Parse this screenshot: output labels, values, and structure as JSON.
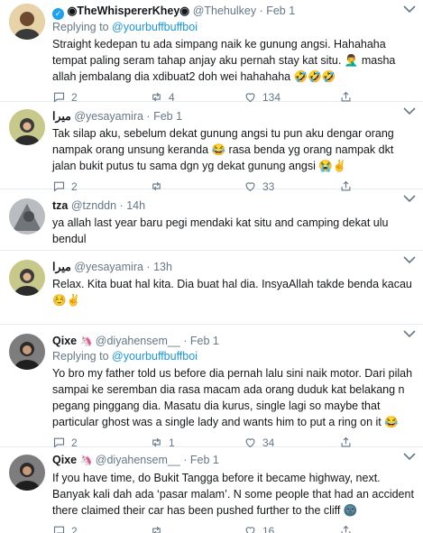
{
  "tweets": [
    {
      "name": "◉TheWhispererKhey◉",
      "handle": "@Thehulkey",
      "date": "Feb 1",
      "reply_label": "Replying to",
      "reply_to": "@yourbuffbuffboi",
      "text": "Straight kedepan tu ada simpang naik ke gunung angsi. Hahahaha tempat paling seram tahap anjay aku pernah stay kat situ. 🤦‍♂️ masha allah jembalang dia xdibuat2 doh wei hahahaha 🤣🤣🤣",
      "replies": "2",
      "retweets": "4",
      "likes": "134",
      "avatar_color": "#d9b98a"
    },
    {
      "name": "ميرا",
      "handle": "@yesayamira",
      "date": "Feb 1",
      "text": "Tak silap aku, sebelum dekat gunung angsi tu pun aku dengar orang nampak orang unsung keranda 😂 rasa benda yg orang nampak dkt jalan bukit putus tu sama dgn yg dekat gunung angsi 😭✌️",
      "replies": "2",
      "retweets": "",
      "likes": "33",
      "avatar_color": "#8a9a5b"
    },
    {
      "name": "tza",
      "handle": "@tznddn",
      "date": "14h",
      "text": "ya allah last year baru pegi mendaki kat situ and camping dekat ulu bendul",
      "replies": "",
      "retweets": "",
      "likes": "",
      "avatar_color": "#9aa0a6"
    },
    {
      "name": "ميرا",
      "handle": "@yesayamira",
      "date": "13h",
      "text": "Relax. Kita buat hal kita. Dia buat hal dia. InsyaAllah takde benda kacau ☺️✌️",
      "replies": "",
      "retweets": "",
      "likes": "",
      "avatar_color": "#8a9a5b"
    },
    {
      "name": "Qixe",
      "name_icon": "🦄",
      "handle": "@diyahensem__",
      "date": "Feb 1",
      "reply_label": "Replying to",
      "reply_to": "@yourbuffbuffboi",
      "text": "Yo bro my father told us before dia pernah lalu sini naik motor. Dari pilah sampai ke seremban dia rasa macam ada orang duduk kat belakang n pegang pinggang dia. Masatu dia kurus, single lagi so maybe that particular ghost was a single lady and wants him to put a ring on it 😂",
      "replies": "2",
      "retweets": "1",
      "likes": "34",
      "avatar_color": "#5a5a5a"
    },
    {
      "name": "Qixe",
      "name_icon": "🦄",
      "handle": "@diyahensem__",
      "date": "Feb 1",
      "text": "If you have time, do Bukit Tangga before it became highway, next. Banyak kali dah ada ‘pasar malam’. N some people that had an accident there claimed their car has been pushed further to the cliff 🌚",
      "replies": "2",
      "retweets": "",
      "likes": "16",
      "avatar_color": "#5a5a5a"
    }
  ],
  "icons": {
    "reply": "reply-icon",
    "retweet": "retweet-icon",
    "like": "heart-icon",
    "share": "share-icon",
    "more": "chevron-down-icon",
    "verified": "verified-icon"
  }
}
